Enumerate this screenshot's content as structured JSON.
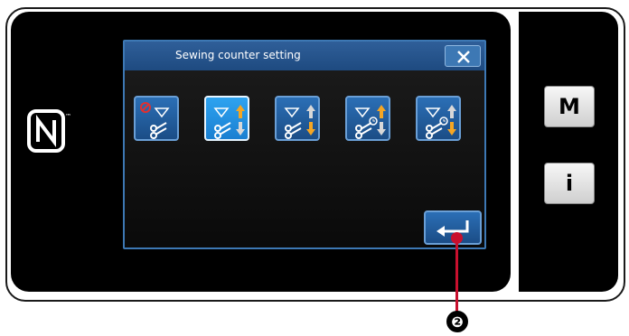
{
  "dialog": {
    "title": "Sewing counter setting"
  },
  "icons": {
    "close": "close-icon",
    "enter": "enter-icon",
    "nfc": "nfc-icon"
  },
  "modes": [
    {
      "name": "counter-off",
      "selected": false
    },
    {
      "name": "counter-up",
      "selected": true
    },
    {
      "name": "counter-down",
      "selected": false
    },
    {
      "name": "pitch-up",
      "selected": false
    },
    {
      "name": "pitch-down",
      "selected": false
    }
  ],
  "side_buttons": {
    "mode_label": "M",
    "info_label": "i"
  },
  "callout": {
    "number": "❷"
  },
  "colors": {
    "title_bar": "#1e4a80",
    "button_blue": "#2b6fb6",
    "selected_blue": "#2ea3f0",
    "arrow_orange": "#f5a623",
    "callout_red": "#c8102e"
  }
}
